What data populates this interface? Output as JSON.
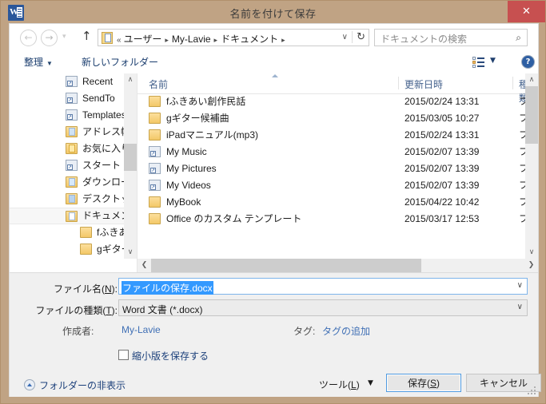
{
  "window": {
    "title": "名前を付けて保存",
    "app_icon": "word-icon",
    "close_label": "✕",
    "frame_color": "#c0a384",
    "close_color": "#c75050"
  },
  "nav": {
    "back_icon": "←",
    "forward_icon": "→",
    "history_icon": "▾",
    "up_icon": "↑",
    "refresh_icon": "↻",
    "dropdown_icon": "∨",
    "breadcrumb_prefix": "«",
    "breadcrumb": [
      "ユーザー",
      "My-Lavie",
      "ドキュメント"
    ],
    "breadcrumb_sep": "▸"
  },
  "search": {
    "placeholder": "ドキュメントの検索",
    "icon": "search-icon",
    "icon_glyph": "⌕"
  },
  "toolbar": {
    "organize_label": "整理",
    "organize_caret": "▼",
    "new_folder_label": "新しいフォルダー",
    "view_icon": "list-view-icon",
    "view_caret": "▼",
    "help_label": "?"
  },
  "nav_pane": {
    "items": [
      {
        "label": "Recent",
        "icon": "shortcut-icon",
        "indent": 0
      },
      {
        "label": "SendTo",
        "icon": "shortcut-icon",
        "indent": 0
      },
      {
        "label": "Templates",
        "icon": "shortcut-icon",
        "indent": 0
      },
      {
        "label": "アドレス帳",
        "icon": "folder-contacts-icon",
        "indent": 0
      },
      {
        "label": "お気に入り",
        "icon": "folder-favorites-icon",
        "indent": 0
      },
      {
        "label": "スタート メニュー",
        "icon": "shortcut-icon",
        "indent": 0
      },
      {
        "label": "ダウンロード",
        "icon": "folder-downloads-icon",
        "indent": 0
      },
      {
        "label": "デスクトップ",
        "icon": "folder-desktop-icon",
        "indent": 0
      },
      {
        "label": "ドキュメント",
        "icon": "folder-documents-icon",
        "indent": 0,
        "selected": true
      },
      {
        "label": "fふきあい創作民話",
        "icon": "folder-icon",
        "indent": 1
      },
      {
        "label": "gギター候補曲",
        "icon": "folder-icon",
        "indent": 1
      }
    ]
  },
  "file_list": {
    "columns": [
      "名前",
      "更新日時",
      "種類"
    ],
    "sort_column": "名前",
    "sort_direction": "asc",
    "rows": [
      {
        "name": "fふきあい創作民話",
        "date": "2015/02/24 13:31",
        "type": "ファ",
        "icon": "folder-icon"
      },
      {
        "name": "gギター候補曲",
        "date": "2015/03/05 10:27",
        "type": "ファ",
        "icon": "folder-icon"
      },
      {
        "name": "iPadマニュアル(mp3)",
        "date": "2015/02/24 13:31",
        "type": "ファ",
        "icon": "folder-icon"
      },
      {
        "name": "My Music",
        "date": "2015/02/07 13:39",
        "type": "ファ",
        "icon": "shortcut-icon"
      },
      {
        "name": "My Pictures",
        "date": "2015/02/07 13:39",
        "type": "ファ",
        "icon": "shortcut-icon"
      },
      {
        "name": "My Videos",
        "date": "2015/02/07 13:39",
        "type": "ファ",
        "icon": "shortcut-icon"
      },
      {
        "name": "MyBook",
        "date": "2015/04/22 10:42",
        "type": "ファ",
        "icon": "folder-icon"
      },
      {
        "name": "Office のカスタム テンプレート",
        "date": "2015/03/17 12:53",
        "type": "ファ",
        "icon": "folder-icon"
      }
    ]
  },
  "form": {
    "filename_label": "ファイル名(N):",
    "filename_value": "ファイルの保存.docx",
    "filename_selected": true,
    "filetype_label": "ファイルの種類(T):",
    "filetype_value": "Word 文書 (*.docx)",
    "author_label": "作成者:",
    "author_value": "My-Lavie",
    "tags_label": "タグ:",
    "tags_value": "タグの追加",
    "thumbnail_label": "縮小版を保存する",
    "thumbnail_checked": false,
    "dropdown_icon": "∨"
  },
  "footer": {
    "hide_folders_label": "フォルダーの非表示",
    "tools_label": "ツール(L)",
    "tools_caret": "▼",
    "save_label": "保存(S)",
    "cancel_label": "キャンセル"
  },
  "scrollbars": {
    "up_arrow": "∧",
    "down_arrow": "∨",
    "left_arrow": "❮",
    "right_arrow": "❯"
  }
}
